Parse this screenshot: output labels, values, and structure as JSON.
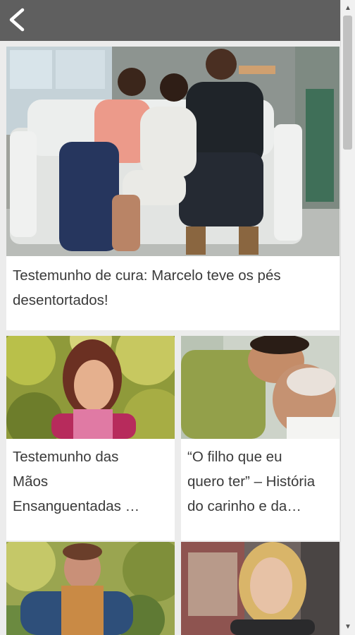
{
  "header": {
    "back_icon": "chevron-left-icon",
    "background": "#5f5f5f"
  },
  "cards": [
    {
      "title": "Testemunho de cura: Marcelo teve os pés\ndesentortados!"
    },
    {
      "title": "Testemunho das\nMãos\nEnsanguentadas …"
    },
    {
      "title": "“O filho que eu\nquero ter” – História\ndo carinho e da…"
    },
    {
      "title": ""
    },
    {
      "title": ""
    }
  ]
}
